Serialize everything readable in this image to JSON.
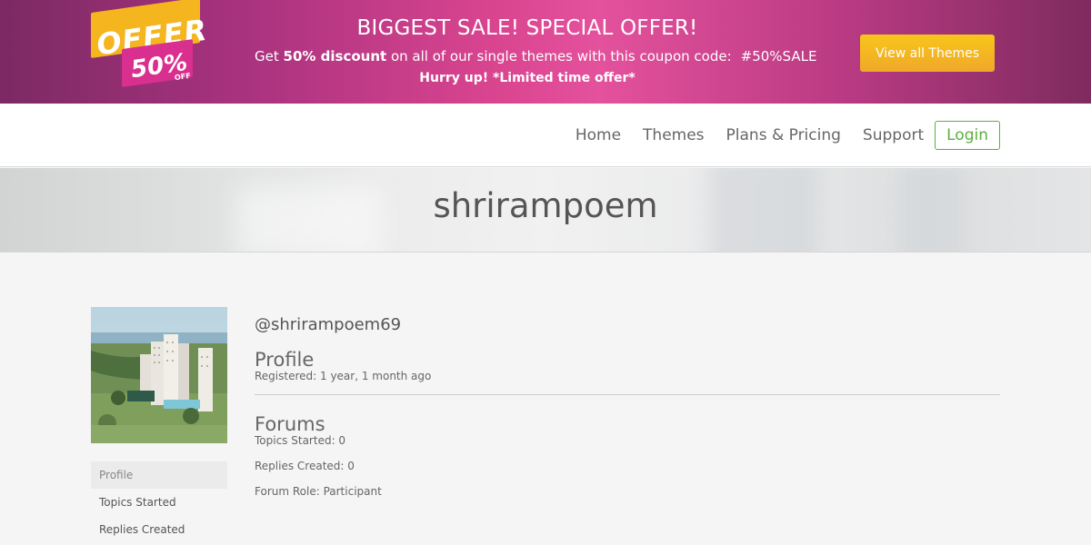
{
  "promo": {
    "badge_offer": "OFFER",
    "badge_percent": "50%",
    "badge_off": "OFF",
    "title": "BIGGEST SALE! SPECIAL OFFER!",
    "line_prefix": "Get ",
    "line_bold": "50% discount",
    "line_middle": " on all of our single themes with this coupon code:",
    "coupon_code": "#50%SALE",
    "hurry": "Hurry up! *Limited time offer*",
    "button_label": "View all Themes",
    "accent_color": "#e4519c",
    "button_color": "#f5b51f"
  },
  "nav": {
    "items": [
      "Home",
      "Themes",
      "Plans & Pricing",
      "Support"
    ],
    "login": "Login",
    "login_color": "#5ab03c"
  },
  "header": {
    "title": "shrirampoem"
  },
  "profile": {
    "handle": "@shrirampoem69",
    "profile_heading": "Profile",
    "registered": "Registered: 1 year, 1 month ago",
    "forums_heading": "Forums",
    "topics_started": "Topics Started: 0",
    "replies_created": "Replies Created: 0",
    "forum_role": "Forum Role: Participant"
  },
  "sidebar": {
    "items": [
      "Profile",
      "Topics Started",
      "Replies Created"
    ],
    "active_index": 0
  }
}
